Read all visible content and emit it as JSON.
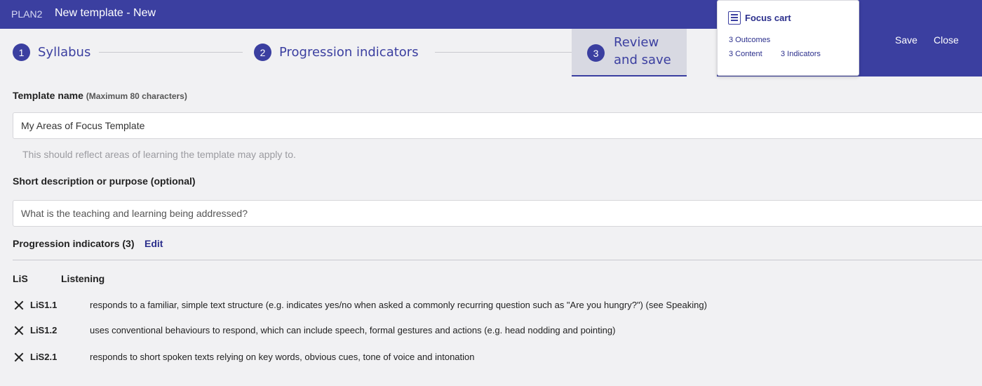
{
  "header": {
    "app_name": "PLAN2",
    "title": "New template - New",
    "save_label": "Save",
    "close_label": "Close"
  },
  "steps": [
    {
      "number": "1",
      "label": "Syllabus"
    },
    {
      "number": "2",
      "label": "Progression indicators"
    },
    {
      "number": "3",
      "label_line1": "Review",
      "label_line2": "and save",
      "active": true
    }
  ],
  "focus_cart": {
    "icon": "list-icon",
    "title": "Focus cart",
    "outcomes": "3 Outcomes",
    "content": "3 Content",
    "indicators": "3 Indicators"
  },
  "form": {
    "template_name_label": "Template name",
    "template_name_note": "(Maximum 80 characters)",
    "template_name_value": "My Areas of Focus Template",
    "template_name_hint": "This should reflect areas of learning the template may apply to.",
    "description_label": "Short description or purpose (optional)",
    "description_placeholder": "What is the teaching and learning being addressed?"
  },
  "progression": {
    "heading": "Progression indicators (3)",
    "edit_label": "Edit",
    "group_code": "LiS",
    "group_name": "Listening",
    "items": [
      {
        "code": "LiS1.1",
        "text": "responds to a familiar, simple text structure (e.g. indicates yes/no when asked a commonly recurring question such as \"Are you hungry?\") (see Speaking)"
      },
      {
        "code": "LiS1.2",
        "text": "uses conventional behaviours to respond, which can include speech, formal gestures and actions (e.g. head nodding and pointing)"
      },
      {
        "code": "LiS2.1",
        "text": "responds to short spoken texts relying on key words, obvious cues, tone of voice and intonation"
      }
    ]
  },
  "colors": {
    "brand": "#3b3fa0",
    "link": "#2b2f8c",
    "background": "#f1f1f3"
  }
}
